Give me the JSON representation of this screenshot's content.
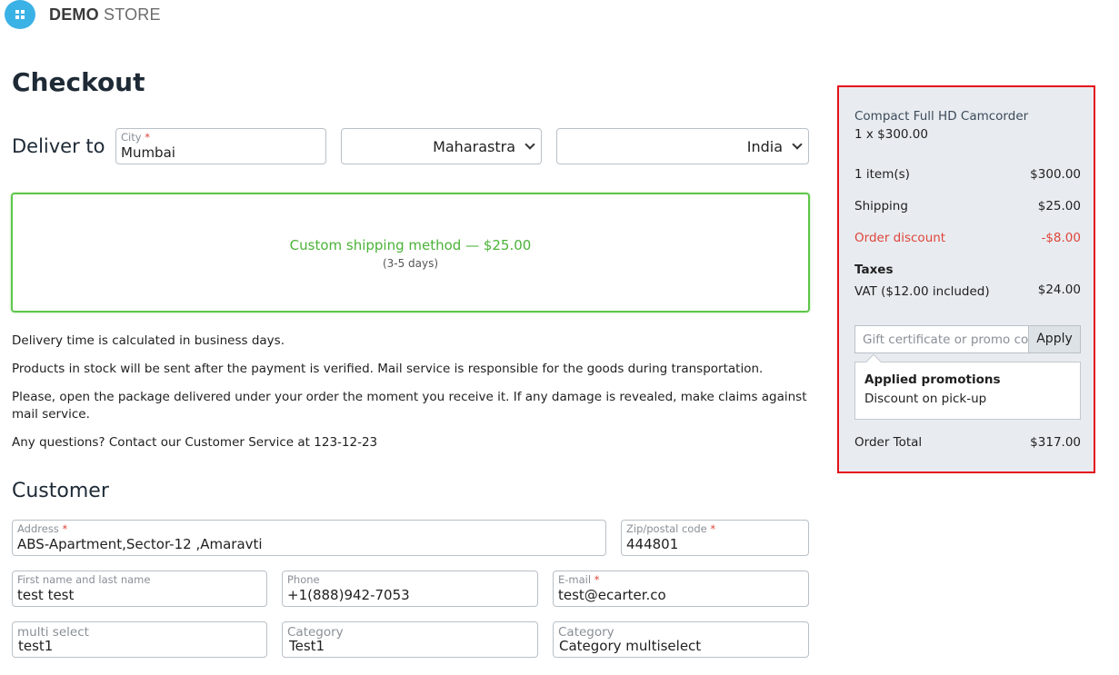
{
  "header": {
    "brand_bold": "DEMO",
    "brand_light": "STORE",
    "logo_icon": "store-logo-icon"
  },
  "page_title": "Checkout",
  "deliver": {
    "label": "Deliver to",
    "city_label": "City",
    "city_value": "Mumbai",
    "state_value": "Maharastra",
    "country_value": "India"
  },
  "shipping": {
    "method": "Custom shipping method — $25.00",
    "days": "(3-5 days)",
    "accent_color": "#4ab337"
  },
  "info": [
    "Delivery time is calculated in business days.",
    "Products in stock will be sent after the payment is verified. Mail service is responsible for the goods during transportation.",
    "Please, open the package delivered under your order the moment you receive it. If any damage is revealed, make claims against mail service.",
    "Any questions? Contact our Customer Service at 123-12-23"
  ],
  "customer": {
    "heading": "Customer",
    "address_label": "Address",
    "address_value": "ABS-Apartment,Sector-12 ,Amaravti",
    "zip_label": "Zip/postal code",
    "zip_value": "444801",
    "name_label": "First name and last name",
    "name_value": "test test",
    "phone_label": "Phone",
    "phone_value": "+1(888)942-7053",
    "email_label": "E-mail",
    "email_value": "test@ecarter.co",
    "multi_label": "multi select",
    "multi_value": "test1",
    "category_label": "Category",
    "category_value": "Test1",
    "category2_label": "Category",
    "category2_value": "Category multiselect"
  },
  "summary": {
    "product_name": "Compact Full HD Camcorder",
    "product_qty": "1 x $300.00",
    "items_label": "1 item(s)",
    "items_value": "$300.00",
    "shipping_label": "Shipping",
    "shipping_value": "$25.00",
    "discount_label": "Order discount",
    "discount_value": "-$8.00",
    "taxes_label": "Taxes",
    "vat_label": "VAT ($12.00 included)",
    "vat_value": "$24.00",
    "promo_placeholder": "Gift certificate or promo code",
    "apply_label": "Apply",
    "promotions_title": "Applied promotions",
    "promotions_text": "Discount on pick-up",
    "total_label": "Order Total",
    "total_value": "$317.00",
    "highlight_color": "#e5101a"
  }
}
